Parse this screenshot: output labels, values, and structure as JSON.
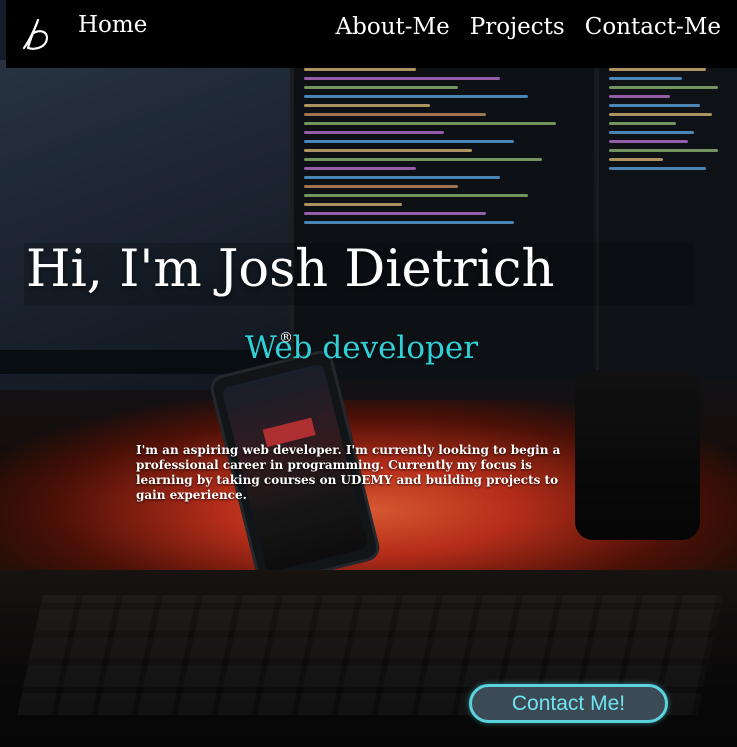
{
  "nav": {
    "logo_icon": "signature-jd-logo-icon",
    "home": "Home",
    "links": [
      "About-Me",
      "Projects",
      "Contact-Me"
    ]
  },
  "hero": {
    "title": "Hi, I'm Josh Dietrich",
    "subtitle": "Web developer",
    "registered_mark": "®",
    "description": "I'm an aspiring web developer. I'm currently looking to begin a professional career in programming. Currently my focus is learning by taking courses on UDEMY and building projects to gain experience."
  },
  "cta": {
    "label": "Contact Me!"
  },
  "colors": {
    "accent": "#2fd0d8",
    "nav_background": "#000000",
    "button_background": "#3c4a56",
    "button_border": "#5ad3df"
  }
}
